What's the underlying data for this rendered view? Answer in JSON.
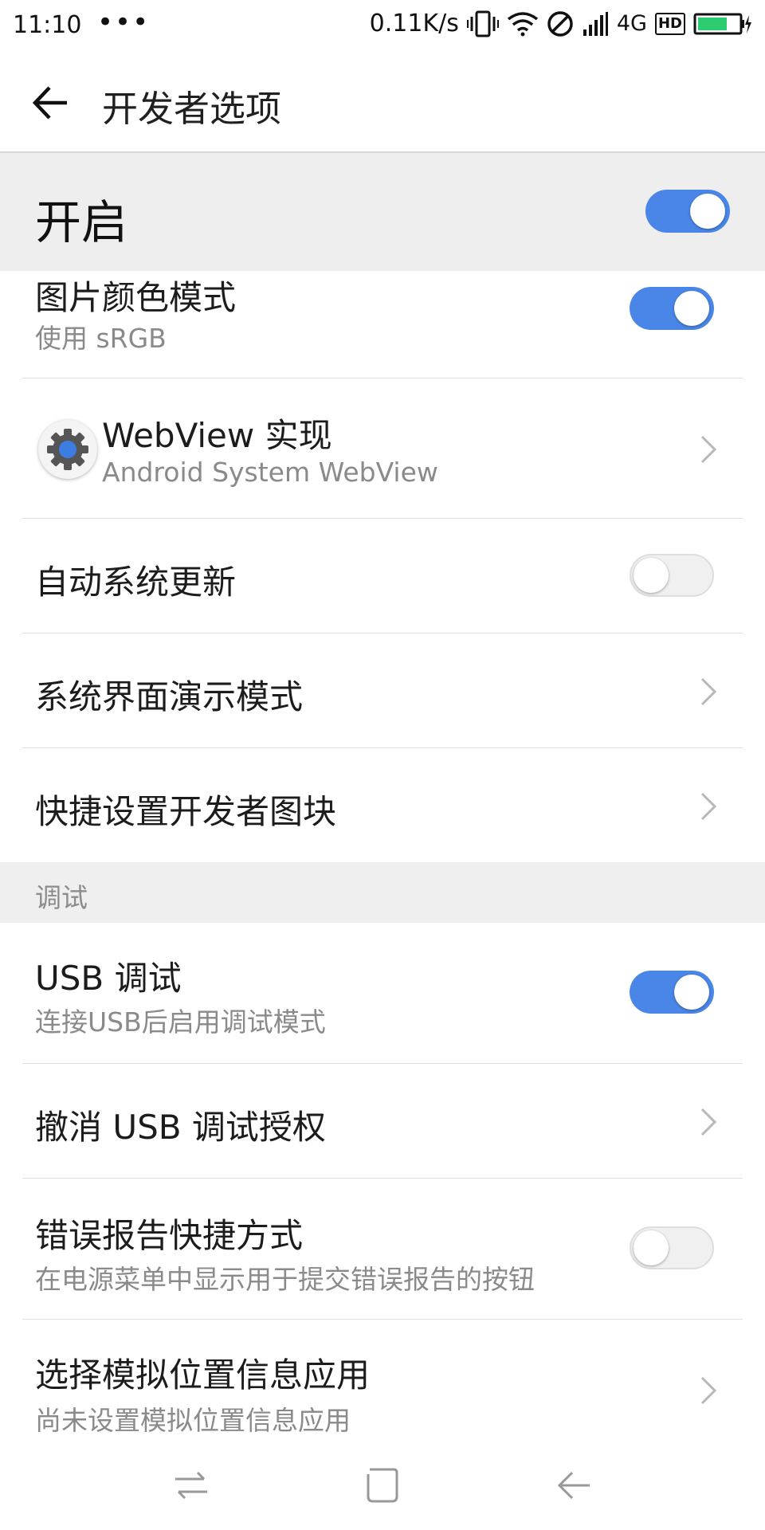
{
  "status_bar": {
    "time": "11:10",
    "dots": "•••",
    "speed": "0.11K/s",
    "network": "4G",
    "hd": "HD"
  },
  "app_bar": {
    "title": "开发者选项"
  },
  "master": {
    "label": "开启",
    "enabled": true
  },
  "rows": {
    "picture_color": {
      "title": "图片颜色模式",
      "subtitle": "使用 sRGB",
      "enabled": true
    },
    "webview": {
      "title": "WebView 实现",
      "subtitle": "Android System WebView"
    },
    "auto_update": {
      "title": "自动系统更新",
      "enabled": false
    },
    "demo_mode": {
      "title": "系统界面演示模式"
    },
    "quick_tiles": {
      "title": "快捷设置开发者图块"
    },
    "usb_debug": {
      "title": "USB 调试",
      "subtitle": "连接USB后启用调试模式",
      "enabled": true
    },
    "revoke_usb": {
      "title": "撤消 USB 调试授权"
    },
    "bug_report": {
      "title": "错误报告快捷方式",
      "subtitle": "在电源菜单中显示用于提交错误报告的按钮",
      "enabled": false
    },
    "mock_location": {
      "title": "选择模拟位置信息应用",
      "subtitle": "尚未设置模拟位置信息应用"
    }
  },
  "section": {
    "debug_header": "调试"
  },
  "colors": {
    "accent": "#4a86e8",
    "header_bg": "#eeeeee"
  },
  "icons": [
    "back-arrow-icon",
    "gear-icon",
    "chevron-right-icon",
    "switch-apps-icon",
    "home-icon",
    "back-icon"
  ]
}
